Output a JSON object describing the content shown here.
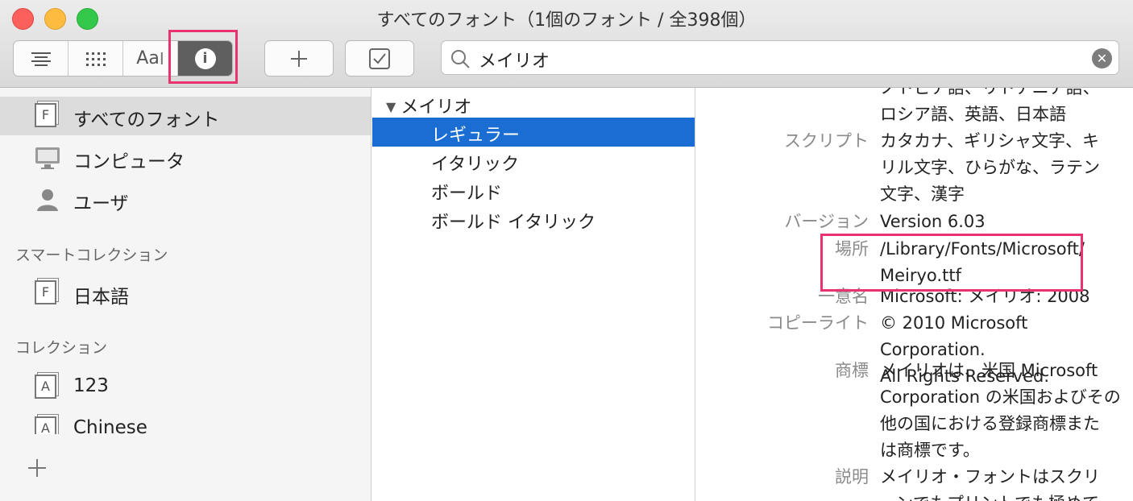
{
  "window": {
    "title": "すべてのフォント（1個のフォント / 全398個）"
  },
  "toolbar": {
    "view_buttons": [
      {
        "name": "list-view",
        "label": ""
      },
      {
        "name": "grid-view",
        "label": ""
      },
      {
        "name": "sample-view",
        "label": "Aa"
      },
      {
        "name": "info-view",
        "label": "i"
      }
    ],
    "search_value": "メイリオ"
  },
  "sidebar": {
    "library_items": [
      {
        "label": "すべてのフォント",
        "icon": "font-collection-icon"
      },
      {
        "label": "コンピュータ",
        "icon": "computer-icon"
      },
      {
        "label": "ユーザ",
        "icon": "user-icon"
      }
    ],
    "smart_heading": "スマートコレクション",
    "smart_items": [
      {
        "label": "日本語",
        "icon_letter": "F"
      }
    ],
    "collections_heading": "コレクション",
    "collection_items": [
      {
        "label": "123",
        "icon_letter": "A"
      },
      {
        "label": "Chinese",
        "icon_letter": "A"
      }
    ],
    "font_icon_letter": "F"
  },
  "fonts": {
    "family": "メイリオ",
    "faces": [
      "レギュラー",
      "イタリック",
      "ボールド",
      "ボールド イタリック"
    ]
  },
  "info": {
    "languages_tail": [
      "ノトピア語、リトアニア語、",
      "ロシア語、英語、日本語"
    ],
    "rows": [
      {
        "key": "スクリプト",
        "lines": [
          "カタカナ、ギリシャ文字、キ",
          "リル文字、ひらがな、ラテン",
          "文字、漢字"
        ]
      },
      {
        "key": "バージョン",
        "lines": [
          "Version 6.03"
        ]
      },
      {
        "key": "場所",
        "lines": [
          "/Library/Fonts/Microsoft/",
          "Meiryo.ttf"
        ]
      },
      {
        "key": "一意名",
        "lines": [
          "Microsoft: メイリオ: 2008"
        ]
      },
      {
        "key": "コピーライト",
        "lines": [
          "© 2010 Microsoft Corporation.",
          "All Rights Reserved."
        ]
      },
      {
        "key": "商標",
        "lines": [
          "メイリオは、米国 Microsoft",
          "Corporation の米国およびその",
          "他の国における登録商標また",
          "は商標です。"
        ]
      },
      {
        "key": "説明",
        "lines": [
          "メイリオ・フォントはスクリ",
          "ーンでもプリントでも極めて"
        ]
      }
    ]
  },
  "colors": {
    "selection": "#1a6ed3",
    "highlight_box": "#e8336e",
    "active_segment": "#5f5f5f"
  }
}
